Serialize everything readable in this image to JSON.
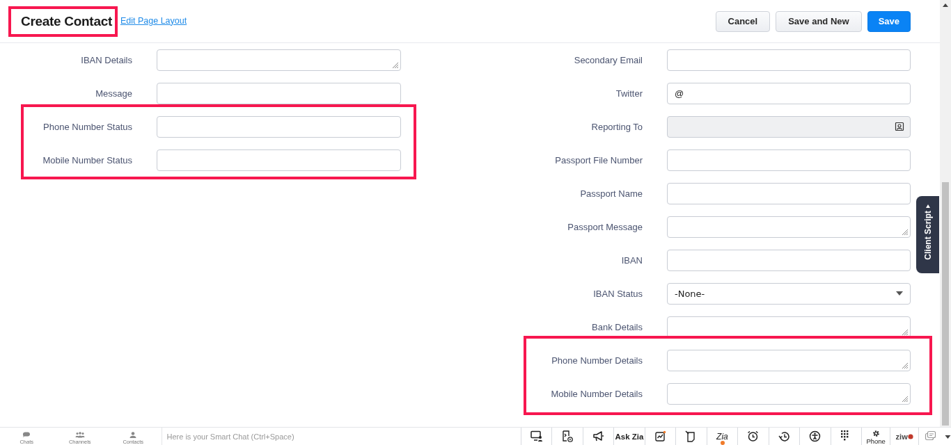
{
  "header": {
    "title": "Create Contact",
    "title_highlighted": true,
    "link": "Edit Page Layout",
    "buttons": [
      {
        "label": "Cancel",
        "kind": "secondary"
      },
      {
        "label": "Save and New",
        "kind": "secondary"
      },
      {
        "label": "Save",
        "kind": "primary"
      }
    ]
  },
  "form": {
    "columns": [
      {
        "groups": [
          {
            "highlighted": false,
            "fields": [
              {
                "label": "IBAN Details",
                "kind": "textarea"
              },
              {
                "label": "Message",
                "kind": "text"
              }
            ]
          },
          {
            "highlighted": true,
            "fields": [
              {
                "label": "Phone Number Status",
                "kind": "text"
              },
              {
                "label": "Mobile Number Status",
                "kind": "text"
              }
            ]
          }
        ]
      },
      {
        "groups": [
          {
            "highlighted": false,
            "fields": [
              {
                "label": "Secondary Email",
                "kind": "text"
              },
              {
                "label": "Twitter",
                "kind": "text",
                "value": "@"
              },
              {
                "label": "Reporting To",
                "kind": "lookup"
              },
              {
                "label": "Passport File Number",
                "kind": "text"
              },
              {
                "label": "Passport Name",
                "kind": "text"
              },
              {
                "label": "Passport Message",
                "kind": "textarea"
              },
              {
                "label": "IBAN",
                "kind": "text"
              },
              {
                "label": "IBAN Status",
                "kind": "select",
                "value": "-None-"
              },
              {
                "label": "Bank Details",
                "kind": "textarea"
              }
            ]
          },
          {
            "highlighted": true,
            "fields": [
              {
                "label": "Phone Number Details",
                "kind": "textarea"
              },
              {
                "label": "Mobile Number Details",
                "kind": "textarea"
              }
            ]
          }
        ]
      }
    ]
  },
  "client_script_tab": {
    "label": "Client Script"
  },
  "bottom_bar": {
    "tabs": [
      {
        "label": "Chats",
        "kind": "chats"
      },
      {
        "label": "Channels",
        "kind": "channels"
      },
      {
        "label": "Contacts",
        "kind": "contacts"
      }
    ],
    "smart_chat": {
      "placeholder": "Here is your Smart Chat (Ctrl+Space)"
    },
    "tools": [
      {
        "kind": "icon"
      },
      {
        "kind": "icon"
      },
      {
        "kind": "icon"
      },
      {
        "kind": "text",
        "label": "Ask Zia"
      },
      {
        "kind": "icon"
      },
      {
        "kind": "icon"
      },
      {
        "kind": "zia",
        "label": "Zia"
      },
      {
        "kind": "icon"
      },
      {
        "kind": "icon"
      },
      {
        "kind": "icon"
      },
      {
        "kind": "icon"
      },
      {
        "kind": "phone",
        "label": "Phone"
      },
      {
        "kind": "logo",
        "label": "ziw"
      },
      {
        "kind": "icon"
      }
    ]
  }
}
